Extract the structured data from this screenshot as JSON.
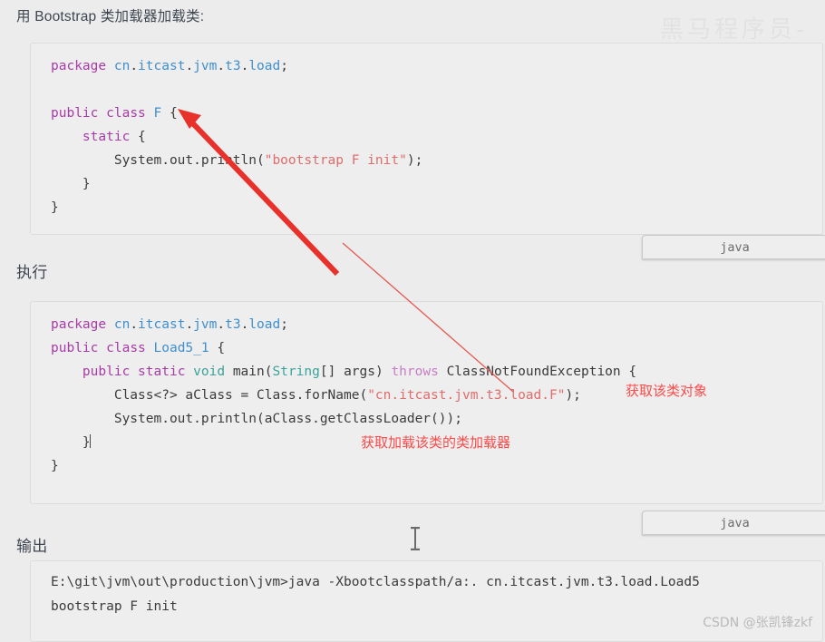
{
  "headings": {
    "top": "用 Bootstrap 类加载器加载类:",
    "exec": "执行",
    "output": "输出"
  },
  "code_block_1": {
    "language_label": "java",
    "lines": [
      "package cn.itcast.jvm.t3.load;",
      "",
      "public class F {",
      "    static {",
      "        System.out.println(\"bootstrap F init\");",
      "    }",
      "}"
    ],
    "tokens": {
      "keyword_package": "package",
      "package_name": "cn.itcast.jvm.t3.load;",
      "keyword_public": "public",
      "keyword_class": "class",
      "class_name": "F",
      "keyword_static": "static",
      "call_system_out_println": "System.out.println(",
      "string_literal": "\"bootstrap F init\"",
      "close": ");"
    }
  },
  "code_block_2": {
    "language_label": "java",
    "lines": [
      "package cn.itcast.jvm.t3.load;",
      "public class Load5_1 {",
      "    public static void main(String[] args) throws ClassNotFoundException {",
      "        Class<?> aClass = Class.forName(\"cn.itcast.jvm.t3.load.F\");",
      "        System.out.println(aClass.getClassLoader());",
      "    }",
      "}"
    ],
    "tokens": {
      "keyword_package": "package",
      "package_name": "cn.itcast.jvm.t3.load;",
      "keyword_public": "public",
      "keyword_class": "class",
      "class_name": "Load5_1",
      "keyword_static": "static",
      "keyword_void": "void",
      "method_main": "main(",
      "type_string": "String",
      "args": "[] args) ",
      "keyword_throws": "throws",
      "exception_type": "ClassNotFoundException {",
      "class_generic": "Class<?> aClass = Class.forName(",
      "string_fqcn": "\"cn.itcast.jvm.t3.load.F\"",
      "close_paren": ");",
      "println_call": "System.out.println(aClass.getClassLoader());"
    }
  },
  "output_block": {
    "lines": [
      "E:\\git\\jvm\\out\\production\\jvm>java -Xbootclasspath/a:. cn.itcast.jvm.t3.load.Load5",
      "bootstrap F init"
    ]
  },
  "annotations": {
    "get_class_object": "获取该类对象",
    "get_class_loader": "获取加载该类的类加载器"
  },
  "watermarks": {
    "top_right": "黑马程序员-",
    "bottom_right": "CSDN @张凯锋zkf"
  },
  "colors": {
    "background": "#ececed",
    "code_background": "#efeeee",
    "code_border": "#dddcdc",
    "keyword": "#a73ba7",
    "type": "#3f8fcf",
    "string": "#e06c6c",
    "green_type": "#3aa39a",
    "plain_text": "#3b3b3b",
    "annotation_red": "#fa4a4a",
    "arrow_red": "#e8312a",
    "thin_line_red": "#e35a52",
    "heading": "#3f4650"
  }
}
